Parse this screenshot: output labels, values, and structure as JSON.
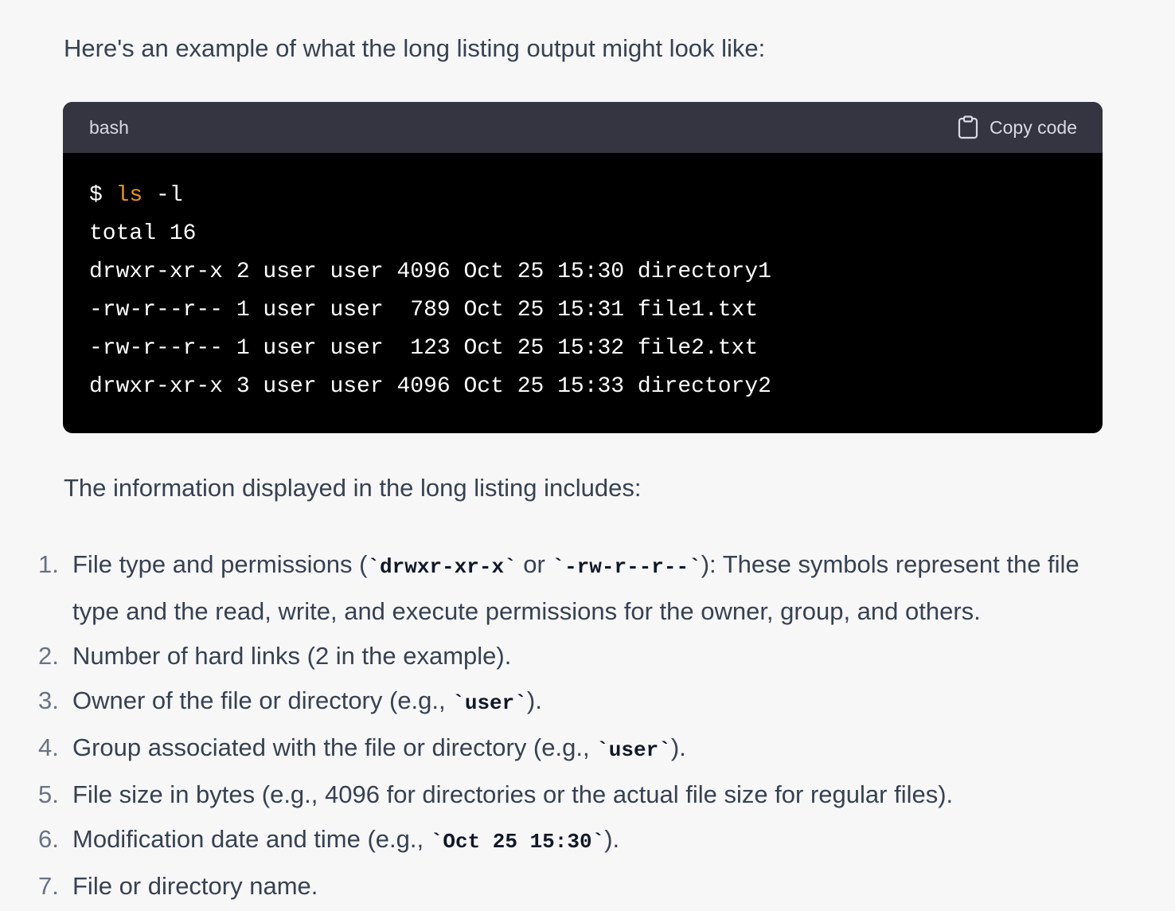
{
  "intro_text": "Here's an example of what the long listing output might look like:",
  "code_block": {
    "language": "bash",
    "copy_label": "Copy code",
    "copy_icon": "clipboard-icon",
    "colors": {
      "header_bg": "#343541",
      "body_bg": "#000000",
      "command": "#e9950c"
    },
    "command": {
      "prompt": "$ ",
      "cmd": "ls",
      "args": " -l"
    },
    "lines": [
      "total 16",
      "drwxr-xr-x 2 user user 4096 Oct 25 15:30 directory1",
      "-rw-r--r-- 1 user user  789 Oct 25 15:31 file1.txt",
      "-rw-r--r-- 1 user user  123 Oct 25 15:32 file2.txt",
      "drwxr-xr-x 3 user user 4096 Oct 25 15:33 directory2"
    ]
  },
  "info_text": "The information displayed in the long listing includes:",
  "steps": [
    {
      "num": "1.",
      "parts": [
        {
          "t": "File type and permissions ("
        },
        {
          "c": "`drwxr-xr-x`"
        },
        {
          "t": " or "
        },
        {
          "c": "`-rw-r--r--`"
        },
        {
          "t": "): These symbols represent the file type and the read, write, and execute permissions for the owner, group, and others."
        }
      ]
    },
    {
      "num": "2.",
      "parts": [
        {
          "t": "Number of hard links (2 in the example)."
        }
      ]
    },
    {
      "num": "3.",
      "parts": [
        {
          "t": "Owner of the file or directory (e.g., "
        },
        {
          "c": "`user`"
        },
        {
          "t": ")."
        }
      ]
    },
    {
      "num": "4.",
      "parts": [
        {
          "t": "Group associated with the file or directory (e.g., "
        },
        {
          "c": "`user`"
        },
        {
          "t": ")."
        }
      ]
    },
    {
      "num": "5.",
      "parts": [
        {
          "t": "File size in bytes (e.g., 4096 for directories or the actual file size for regular files)."
        }
      ]
    },
    {
      "num": "6.",
      "parts": [
        {
          "t": "Modification date and time (e.g., "
        },
        {
          "c": "`Oct 25 15:30`"
        },
        {
          "t": ")."
        }
      ]
    },
    {
      "num": "7.",
      "parts": [
        {
          "t": "File or directory name."
        }
      ]
    }
  ]
}
